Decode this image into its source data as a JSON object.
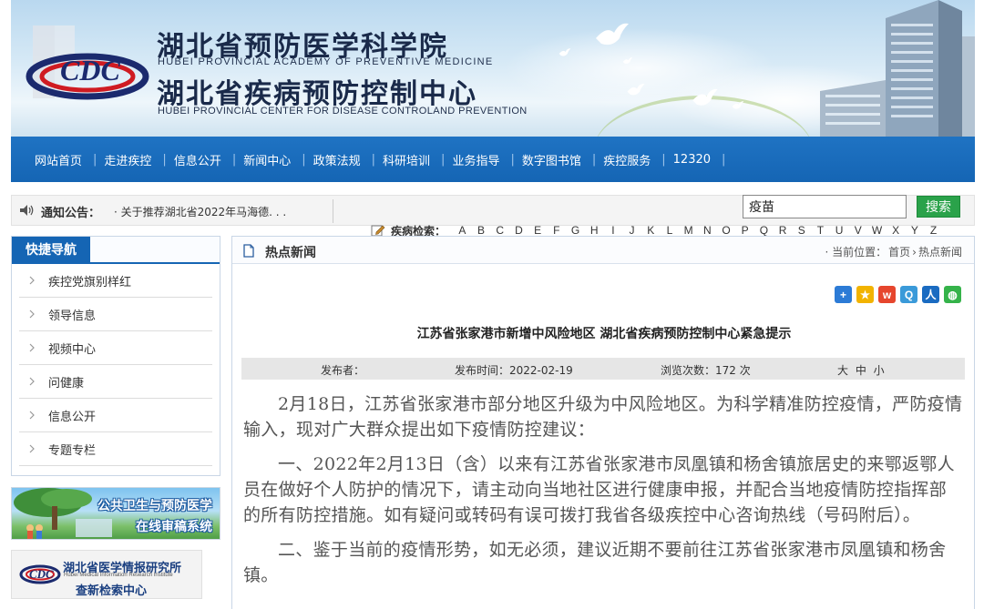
{
  "header": {
    "org_cn_1": "湖北省预防医学科学院",
    "org_en_1": "HUBEI PROVINCIAL ACADEMY OF PREVENTIVE MEDICINE",
    "org_cn_2": "湖北省疾病预防控制中心",
    "org_en_2": "HUBEI PROVINCIAL CENTER FOR DISEASE CONTROLAND PREVENTION",
    "logo_icon": "cdc-logo-icon"
  },
  "nav": {
    "items": [
      {
        "label": "网站首页"
      },
      {
        "label": "走进疾控"
      },
      {
        "label": "信息公开"
      },
      {
        "label": "新闻中心"
      },
      {
        "label": "政策法规"
      },
      {
        "label": "科研培训"
      },
      {
        "label": "业务指导"
      },
      {
        "label": "数字图书馆"
      },
      {
        "label": "疾控服务"
      },
      {
        "label": "12320"
      }
    ],
    "separator": "|"
  },
  "notice": {
    "label": "通知公告：",
    "text": "· 关于推荐湖北省2022年马海德. . ."
  },
  "search": {
    "value": "疫苗",
    "button_label": "搜索"
  },
  "disease_search": {
    "label": "疾病检索：",
    "letters": [
      "A",
      "B",
      "C",
      "D",
      "E",
      "F",
      "G",
      "H",
      "I",
      "J",
      "K",
      "L",
      "M",
      "N",
      "O",
      "P",
      "Q",
      "R",
      "S",
      "T",
      "U",
      "V",
      "W",
      "X",
      "Y",
      "Z"
    ]
  },
  "quicknav": {
    "title": "快捷导航",
    "items": [
      {
        "label": "疾控党旗别样红"
      },
      {
        "label": "领导信息"
      },
      {
        "label": "视频中心"
      },
      {
        "label": "问健康"
      },
      {
        "label": "信息公开"
      },
      {
        "label": "专题专栏"
      }
    ]
  },
  "ads": {
    "ad1_line1": "公共卫生与预防医学",
    "ad1_line2": "在线审稿系统",
    "ad2_line1": "湖北省医学情报研究所",
    "ad2_line2": "Hubei Medical Information Research Institute",
    "ad2_line3": "查新检索中心"
  },
  "main": {
    "section_title": "热点新闻",
    "breadcrumb_prefix": "· 当前位置：",
    "breadcrumb_home": "首页",
    "breadcrumb_sep": "›",
    "breadcrumb_current": "热点新闻",
    "share_icons": [
      "plus-share-icon",
      "qzone-icon",
      "weibo-icon",
      "tencent-weibo-icon",
      "renren-icon",
      "wechat-icon"
    ],
    "article_title": "江苏省张家港市新增中风险地区  湖北省疾病预防控制中心紧急提示",
    "meta": {
      "publisher": "发布者：",
      "date": "发布时间：2022-02-19",
      "views": "浏览次数：172 次",
      "font_size": "大 中 小"
    },
    "paragraphs": [
      "2月18日，江苏省张家港市部分地区升级为中风险地区。为科学精准防控疫情，严防疫情输入，现对广大群众提出如下疫情防控建议：",
      "一、2022年2月13日（含）以来有江苏省张家港市凤凰镇和杨舍镇旅居史的来鄂返鄂人员在做好个人防护的情况下，请主动向当地社区进行健康申报，并配合当地疫情防控指挥部的所有防控措施。如有疑问或转码有误可拨打我省各级疾控中心咨询热线（号码附后）。",
      "二、鉴于当前的疫情形势，如无必须，建议近期不要前往江苏省张家港市凤凰镇和杨舍镇。"
    ]
  },
  "colors": {
    "nav_blue": "#1565b4",
    "search_green": "#2aa24a"
  }
}
